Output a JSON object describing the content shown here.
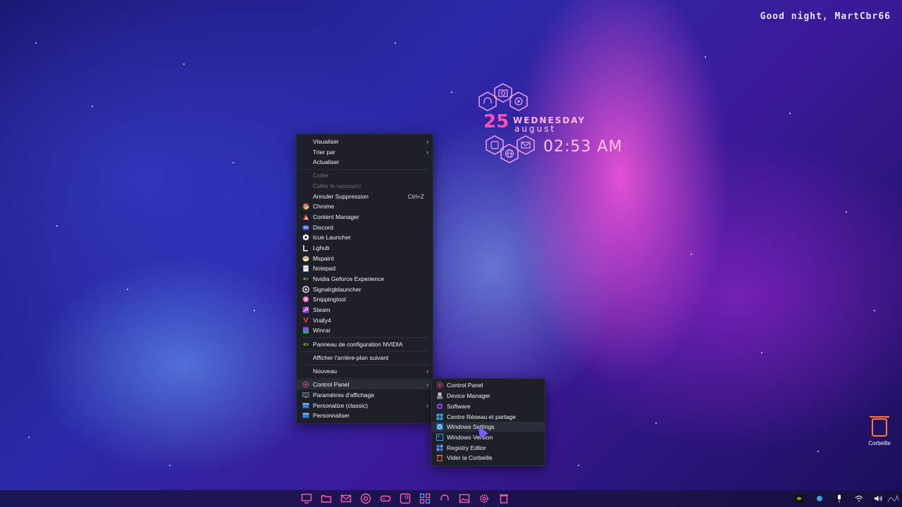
{
  "desktop": {
    "greeting": "Good night, MartCbr66"
  },
  "widget": {
    "day": "25",
    "weekday": "WEDNESDAY",
    "month": "august",
    "time": "02:53 AM"
  },
  "context_menu": {
    "items": [
      {
        "label": "Visualiser",
        "submenu": true
      },
      {
        "label": "Trier par",
        "submenu": true
      },
      {
        "label": "Actualiser"
      },
      {
        "label": "Coller",
        "disabled": true
      },
      {
        "label": "Coller le raccourci",
        "disabled": true
      },
      {
        "label": "Annuler Suppression",
        "shortcut": "Ctrl+Z"
      },
      {
        "label": "Chrome",
        "icon": "chrome-icon"
      },
      {
        "label": "Content Manager",
        "icon": "content-manager-icon"
      },
      {
        "label": "Discord",
        "icon": "discord-icon"
      },
      {
        "label": "Icue Launcher",
        "icon": "icue-icon"
      },
      {
        "label": "Lghub",
        "icon": "lghub-icon"
      },
      {
        "label": "Mspaint",
        "icon": "paint-icon"
      },
      {
        "label": "Notepad",
        "icon": "notepad-icon"
      },
      {
        "label": "Nvidia Geforce Experience",
        "icon": "nvidia-icon"
      },
      {
        "label": "Signalrgblauncher",
        "icon": "signalrgb-icon"
      },
      {
        "label": "Snippingtool",
        "icon": "snipping-icon"
      },
      {
        "label": "Steam",
        "icon": "steam-icon"
      },
      {
        "label": "Vrally4",
        "icon": "vrally-icon"
      },
      {
        "label": "Winrar",
        "icon": "winrar-icon"
      },
      {
        "label": "Panneau de configuration NVIDIA",
        "icon": "nvidia-icon"
      },
      {
        "label": "Afficher l'arrière-plan suivant"
      },
      {
        "label": "Nouveau",
        "submenu": true
      },
      {
        "label": "Control Panel",
        "submenu": true,
        "icon": "control-panel-icon"
      },
      {
        "label": "Paramètres d'affichage",
        "icon": "display-icon"
      },
      {
        "label": "Personalize (classic)",
        "submenu": true,
        "icon": "personalize-icon"
      },
      {
        "label": "Personnaliser",
        "icon": "personalize-icon"
      }
    ]
  },
  "submenu": {
    "items": [
      {
        "label": "Control Panel",
        "icon": "control-panel-icon"
      },
      {
        "label": "Device Manager",
        "icon": "device-manager-icon"
      },
      {
        "label": "Software",
        "icon": "software-icon"
      },
      {
        "label": "Centre Réseau et partage",
        "icon": "network-icon"
      },
      {
        "label": "Windows Settings",
        "icon": "settings-icon"
      },
      {
        "label": "Windows Version",
        "icon": "windows-version-icon"
      },
      {
        "label": "Registry Editor",
        "icon": "registry-icon"
      },
      {
        "label": "Vider la Corbeille",
        "icon": "recycle-bin-icon"
      }
    ]
  },
  "recycle_bin": {
    "label": "Corbeille"
  },
  "colors": {
    "menu_bg": "#1d2029",
    "accent_pink": "#ff4fb3",
    "bin_orange": "#ff7a3a"
  }
}
